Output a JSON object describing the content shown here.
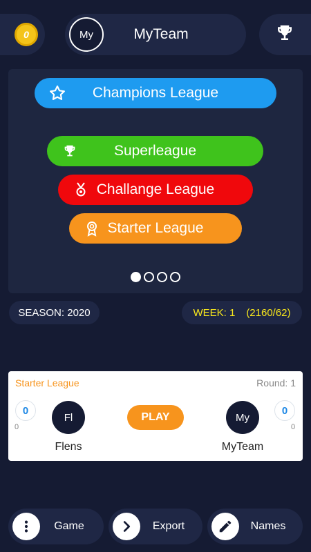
{
  "topbar": {
    "coins": "0",
    "team_avatar": "My",
    "team_name": "MyTeam",
    "trophy_icon": "trophy-icon"
  },
  "leagues": [
    {
      "label": "Champions League",
      "icon": "star-icon",
      "color": "#1e9bf0"
    },
    {
      "label": "Superleague",
      "icon": "trophy-icon",
      "color": "#3fc31c"
    },
    {
      "label": "Challange League",
      "icon": "medal-icon",
      "color": "#f0080c"
    },
    {
      "label": "Starter League",
      "icon": "award-ribbon-icon",
      "color": "#f7941d"
    }
  ],
  "pager": {
    "pages": 4,
    "active": 1
  },
  "season": {
    "label": "SEASON: 2020"
  },
  "week": {
    "label": "WEEK: 1",
    "stats": "(2160/62)"
  },
  "match": {
    "league": "Starter League",
    "round": "Round: 1",
    "home": {
      "score": "0",
      "sub": "0",
      "badge": "Fl",
      "name": "Flens"
    },
    "away": {
      "score": "0",
      "sub": "0",
      "badge": "My",
      "name": "MyTeam"
    },
    "play_label": "PLAY"
  },
  "bottom_nav": [
    {
      "label": "Game",
      "icon": "more-vertical-icon"
    },
    {
      "label": "Export",
      "icon": "chevron-right-icon"
    },
    {
      "label": "Names",
      "icon": "pencil-icon"
    }
  ]
}
